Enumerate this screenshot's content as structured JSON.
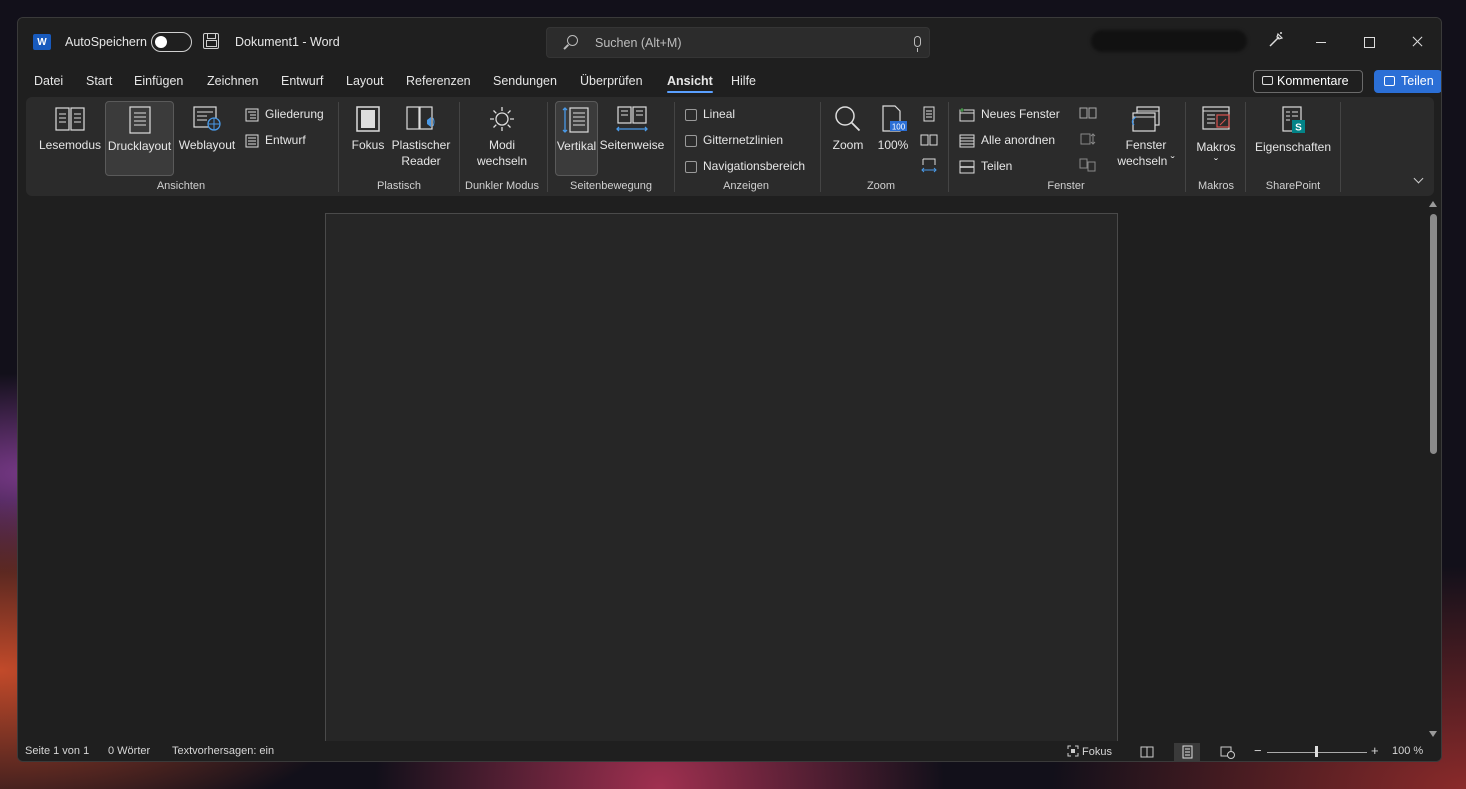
{
  "titlebar": {
    "app_icon_letter": "W",
    "autosave_label": "AutoSpeichern",
    "document_title": "Dokument1  -  Word",
    "search_placeholder": "Suchen (Alt+M)"
  },
  "tabs": [
    {
      "label": "Datei"
    },
    {
      "label": "Start"
    },
    {
      "label": "Einfügen"
    },
    {
      "label": "Zeichnen"
    },
    {
      "label": "Entwurf"
    },
    {
      "label": "Layout"
    },
    {
      "label": "Referenzen"
    },
    {
      "label": "Sendungen"
    },
    {
      "label": "Überprüfen"
    },
    {
      "label": "Ansicht",
      "active": true
    },
    {
      "label": "Hilfe"
    }
  ],
  "header_buttons": {
    "comments": "Kommentare",
    "share": "Teilen"
  },
  "ribbon": {
    "ansichten": {
      "group_label": "Ansichten",
      "lesemodus": "Lesemodus",
      "drucklayout": "Drucklayout",
      "weblayout": "Weblayout",
      "gliederung": "Gliederung",
      "entwurf": "Entwurf"
    },
    "plastisch": {
      "group_label": "Plastisch",
      "fokus": "Fokus",
      "plastischer_reader_1": "Plastischer",
      "plastischer_reader_2": "Reader"
    },
    "dunkler_modus": {
      "group_label": "Dunkler Modus",
      "modi_1": "Modi",
      "modi_2": "wechseln"
    },
    "seitenbewegung": {
      "group_label": "Seitenbewegung",
      "vertikal": "Vertikal",
      "seitenweise": "Seitenweise"
    },
    "anzeigen": {
      "group_label": "Anzeigen",
      "lineal": "Lineal",
      "gitternetzlinien": "Gitternetzlinien",
      "navigationsbereich": "Navigationsbereich"
    },
    "zoom": {
      "group_label": "Zoom",
      "zoom": "Zoom",
      "hundred": "100%",
      "icon_badge": "100"
    },
    "fenster": {
      "group_label": "Fenster",
      "neues_fenster": "Neues Fenster",
      "alle_anordnen": "Alle anordnen",
      "teilen": "Teilen",
      "fenster_wechseln_1": "Fenster",
      "fenster_wechseln_2": "wechseln ˇ"
    },
    "makros": {
      "group_label": "Makros",
      "makros": "Makros",
      "caret": "ˇ"
    },
    "sharepoint": {
      "group_label": "SharePoint",
      "eigenschaften": "Eigenschaften",
      "icon_letter": "S"
    }
  },
  "statusbar": {
    "page": "Seite 1 von 1",
    "words": "0 Wörter",
    "predictions": "Textvorhersagen: ein",
    "focus": "Fokus",
    "zoom_minus": "−",
    "zoom_plus": "+",
    "zoom_level": "100 %"
  },
  "colors": {
    "accent": "#2b6fd6",
    "word_blue": "#185abd",
    "tab_underline": "#5aa0ff",
    "background": "#1f1f1f",
    "ribbon": "#2b2b2b"
  }
}
